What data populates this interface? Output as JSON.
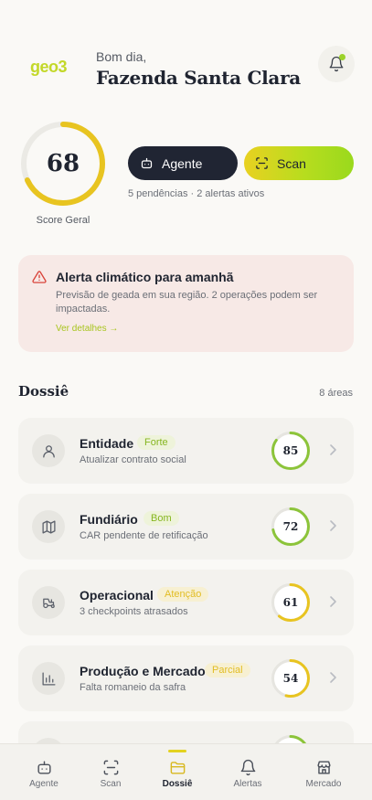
{
  "header": {
    "logo_text": "geo3",
    "greeting": "Bom dia,",
    "farm_name": "Fazenda Santa Clara",
    "notification_icon": "bell-icon"
  },
  "score": {
    "value": "68",
    "percent": 68,
    "label": "Score Geral",
    "color": "#e8c420"
  },
  "actions": {
    "agent_label": "Agente",
    "scan_label": "Scan",
    "pending_text": "5 pendências · 2 alertas ativos"
  },
  "alert": {
    "title": "Alerta climático para amanhã",
    "body": "Previsão de geada em sua região. 2 operações podem ser impactadas.",
    "link": "Ver detalhes →",
    "icon": "warning-icon",
    "color": "#d9433a"
  },
  "dossie": {
    "title": "Dossiê",
    "count": "8 áreas",
    "items": [
      {
        "title": "Entidade",
        "badge": "Forte",
        "subtitle": "Atualizar contrato social",
        "score": "85",
        "percent": 85,
        "icon": "person-icon",
        "badge_bg": "#eef3da",
        "badge_color": "#86b620",
        "ring_color": "#8cc43a"
      },
      {
        "title": "Fundiário",
        "badge": "Bom",
        "subtitle": "CAR pendente de retificação",
        "score": "72",
        "percent": 72,
        "icon": "map-icon",
        "badge_bg": "#eef3da",
        "badge_color": "#86b620",
        "ring_color": "#8cc43a"
      },
      {
        "title": "Operacional",
        "badge": "Atenção",
        "subtitle": "3 checkpoints atrasados",
        "score": "61",
        "percent": 61,
        "icon": "tractor-icon",
        "badge_bg": "#f7f0d2",
        "badge_color": "#e2bd24",
        "ring_color": "#e8c420"
      },
      {
        "title": "Produção e Mercado",
        "badge": "Parcial",
        "subtitle": "Falta romaneio da safra",
        "score": "54",
        "percent": 54,
        "icon": "bar-chart-icon",
        "badge_bg": "#f7f0d2",
        "badge_color": "#e2bd24",
        "ring_color": "#e8c420"
      }
    ]
  },
  "nav": {
    "items": [
      {
        "label": "Agente",
        "icon": "robot-icon"
      },
      {
        "label": "Scan",
        "icon": "scan-icon"
      },
      {
        "label": "Dossiê",
        "icon": "folder-icon"
      },
      {
        "label": "Alertas",
        "icon": "bell-icon"
      },
      {
        "label": "Mercado",
        "icon": "store-icon"
      }
    ],
    "active_index": 2
  }
}
